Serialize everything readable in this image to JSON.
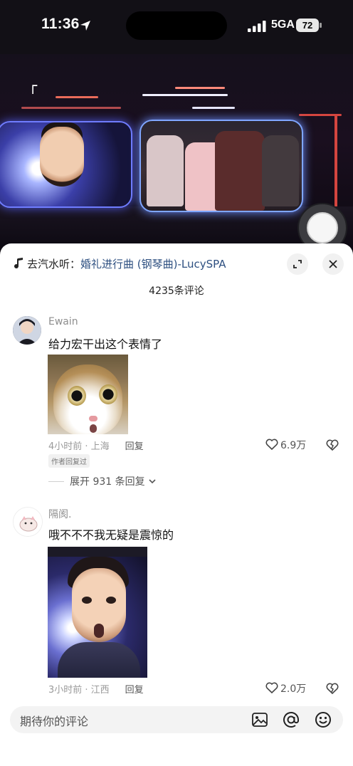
{
  "status_bar": {
    "time": "11:36",
    "network": "5GA",
    "battery": "72"
  },
  "music": {
    "prefix": "去汽水听：",
    "song": "婚礼进行曲 (钢琴曲)-LucySPA"
  },
  "comment_count": "4235条评论",
  "comments": [
    {
      "username": "Ewain",
      "text": "给力宏干出这个表情了",
      "time_location": "4小时前 · 上海",
      "reply_label": "回复",
      "likes": "6.9万",
      "author_tag": "作者回复过",
      "expand_replies": "展开 931 条回复"
    },
    {
      "username": "隔阂.",
      "text": "哦不不不我无疑是震惊的",
      "time_location": "3小时前 · 江西",
      "reply_label": "回复",
      "likes": "2.0万"
    }
  ],
  "input": {
    "placeholder": "期待你的评论"
  },
  "icons": {
    "location": "location-arrow-icon",
    "music": "music-note-icon",
    "expand": "expand-icon",
    "close": "close-icon",
    "like": "heart-icon",
    "dislike": "broken-heart-icon",
    "image": "image-icon",
    "mention": "at-icon",
    "emoji": "emoji-icon"
  },
  "colors": {
    "song_link": "#2d4f80"
  }
}
